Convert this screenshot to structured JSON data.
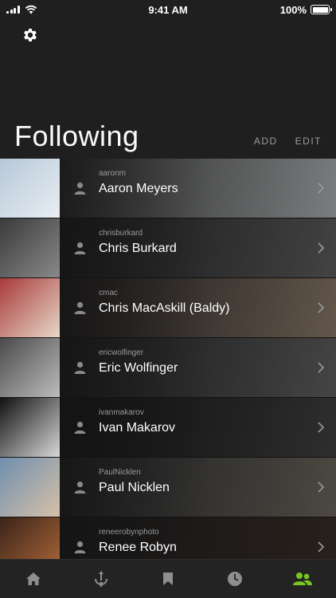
{
  "status_bar": {
    "time": "9:41 AM",
    "battery": "100%"
  },
  "header": {
    "title": "Following",
    "add_label": "ADD",
    "edit_label": "EDIT"
  },
  "following": [
    {
      "username": "aaronm",
      "name": "Aaron Meyers",
      "thumb_colors": [
        "#b7c8d8",
        "#e9eef3"
      ],
      "bg_colors": [
        "#6f6f6f",
        "#cfd3d6"
      ]
    },
    {
      "username": "chrisburkard",
      "name": "Chris Burkard",
      "thumb_colors": [
        "#3a3a3a",
        "#8a8a8a"
      ],
      "bg_colors": [
        "#2a2a2a",
        "#6a6a6a"
      ]
    },
    {
      "username": "cmac",
      "name": "Chris MacAskill (Baldy)",
      "thumb_colors": [
        "#a83a3a",
        "#e7d9c9"
      ],
      "bg_colors": [
        "#3b3330",
        "#a58f7a"
      ]
    },
    {
      "username": "ericwolfinger",
      "name": "Eric Wolfinger",
      "thumb_colors": [
        "#4a4a4a",
        "#bdbdbd"
      ],
      "bg_colors": [
        "#2b2b2b",
        "#6e6e6e"
      ]
    },
    {
      "username": "ivanmakarov",
      "name": "Ivan Makarov",
      "thumb_colors": [
        "#111111",
        "#d9d9d9"
      ],
      "bg_colors": [
        "#111111",
        "#444444"
      ]
    },
    {
      "username": "PaulNicklen",
      "name": "Paul Nicklen",
      "thumb_colors": [
        "#6f8fae",
        "#d7c1a8"
      ],
      "bg_colors": [
        "#3a3d42",
        "#7c7467"
      ]
    },
    {
      "username": "reneerobynphoto",
      "name": "Renee Robyn",
      "thumb_colors": [
        "#3a2418",
        "#b06a3a"
      ],
      "bg_colors": [
        "#1c1c1c",
        "#3a2a22"
      ]
    }
  ],
  "tabs": [
    {
      "icon": "home-icon",
      "active": false
    },
    {
      "icon": "explore-icon",
      "active": false
    },
    {
      "icon": "bookmark-icon",
      "active": false
    },
    {
      "icon": "recent-clock-icon",
      "active": false
    },
    {
      "icon": "following-people-icon",
      "active": true
    }
  ],
  "colors": {
    "accent": "#7ac41f",
    "background": "#1f1f20",
    "tab_inactive": "#8e8e8e"
  }
}
